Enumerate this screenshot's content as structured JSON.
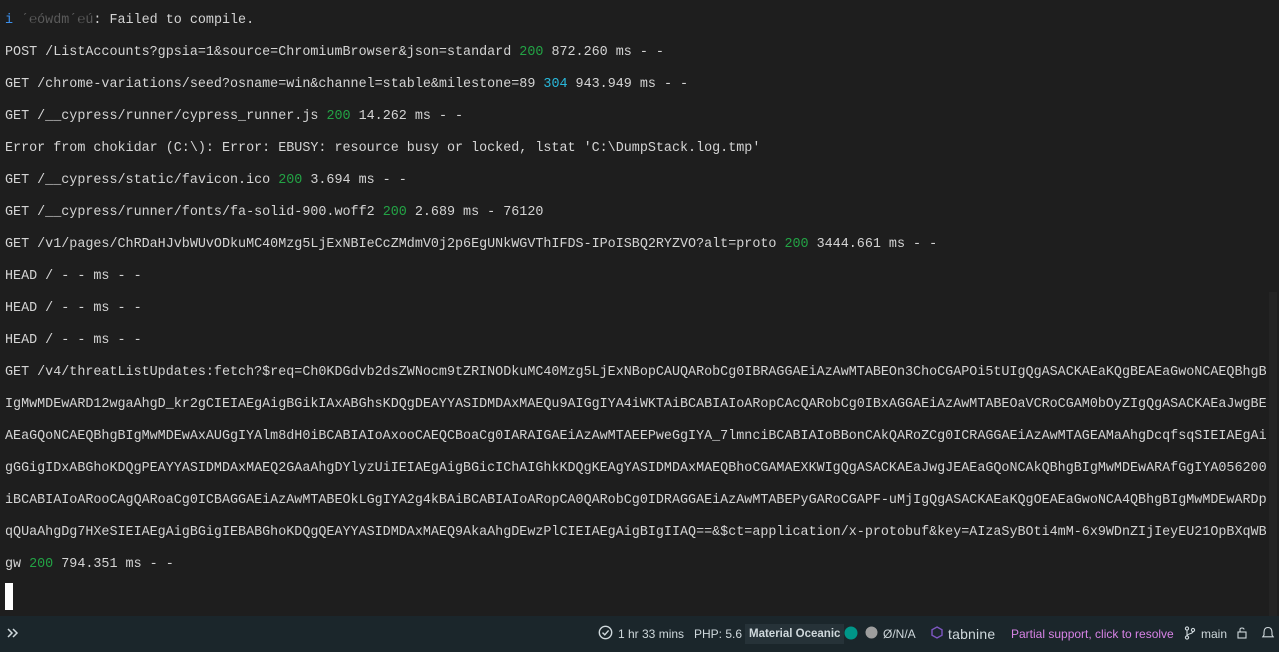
{
  "terminal": {
    "prefix_char": "i",
    "prefix_dim": "ˊ℮ówdmˊ℮ú",
    "status_colors": {
      "200": "#23a345",
      "304": "#29b8db"
    },
    "lines": [
      {
        "segs": [
          {
            "t": "i ",
            "c": "info"
          },
          {
            "t": "ˊ℮ówdmˊ℮ú",
            "c": "dim"
          },
          {
            "t": ": Failed to compile."
          }
        ]
      },
      {
        "segs": [
          {
            "t": "POST /ListAccounts?gpsia=1&source=ChromiumBrowser&json=standard "
          },
          {
            "t": "200",
            "c": "s200"
          },
          {
            "t": " 872.260 ms - -"
          }
        ]
      },
      {
        "segs": [
          {
            "t": "GET /chrome-variations/seed?osname=win&channel=stable&milestone=89 "
          },
          {
            "t": "304",
            "c": "s304"
          },
          {
            "t": " 943.949 ms - -"
          }
        ]
      },
      {
        "segs": [
          {
            "t": "GET /__cypress/runner/cypress_runner.js "
          },
          {
            "t": "200",
            "c": "s200"
          },
          {
            "t": " 14.262 ms - -"
          }
        ]
      },
      {
        "segs": [
          {
            "t": "Error from chokidar (C:\\): Error: EBUSY: resource busy or locked, lstat 'C:\\DumpStack.log.tmp'"
          }
        ]
      },
      {
        "segs": [
          {
            "t": "GET /__cypress/static/favicon.ico "
          },
          {
            "t": "200",
            "c": "s200"
          },
          {
            "t": " 3.694 ms - -"
          }
        ]
      },
      {
        "segs": [
          {
            "t": "GET /__cypress/runner/fonts/fa-solid-900.woff2 "
          },
          {
            "t": "200",
            "c": "s200"
          },
          {
            "t": " 2.689 ms - 76120"
          }
        ]
      },
      {
        "segs": [
          {
            "t": "GET /v1/pages/ChRDaHJvbWUvODkuMC40Mzg5LjExNBIeCcZMdmV0j2p6EgUNkWGVThIFDS-IPoISBQ2RYZVO?alt=proto "
          },
          {
            "t": "200",
            "c": "s200"
          },
          {
            "t": " 3444.661 ms - -"
          }
        ]
      },
      {
        "segs": [
          {
            "t": "HEAD / - - ms - -"
          }
        ]
      },
      {
        "segs": [
          {
            "t": "HEAD / - - ms - -"
          }
        ]
      },
      {
        "segs": [
          {
            "t": "HEAD / - - ms - -"
          }
        ]
      },
      {
        "segs": [
          {
            "t": "GET /v4/threatListUpdates:fetch?$req=Ch0KDGdvb2dsZWNocm9tZRINODkuMC40Mzg5LjExNBopCAUQARobCg0IBRAGGAEiAzAwMTABEOn3ChoCGAPOi5tUIgQgASACKAEaKQgBEAEaGwoNCAEQBhgB"
          }
        ]
      },
      {
        "segs": [
          {
            "t": "IgMwMDEwARD12wgaAhgD_kr2gCIEIAEgAigBGikIAxABGhsKDQgDEAYYASIDMDAxMAEQu9AIGgIYA4iWKTAiBCABIAIoARopCAcQARobCg0IBxAGGAEiAzAwMTABEOaVCRoCGAM0bOyZIgQgASACKAEaJwgBE"
          }
        ]
      },
      {
        "segs": [
          {
            "t": "AEaGQoNCAEQBhgBIgMwMDEwAxAUGgIYAlm8dH0iBCABIAIoAxooCAEQCBoaCg0IARAIGAEiAzAwMTAEEPweGgIYA_7lmnciBCABIAIoBBonCAkQARoZCg0ICRAGGAEiAzAwMTAGEAMaAhgDcqfsqSIEIAEgAi"
          }
        ]
      },
      {
        "segs": [
          {
            "t": "gGGigIDxABGhoKDQgPEAYYASIDMDAxMAEQ2GAaAhgDYlyzUiIEIAEgAigBGicIChAIGhkKDQgKEAgYASIDMDAxMAEQBhoCGAMAEXKWIgQgASACKAEaJwgJEAEaGQoNCAkQBhgBIgMwMDEwARAfGgIYA056200"
          }
        ]
      },
      {
        "segs": [
          {
            "t": "iBCABIAIoARooCAgQARoaCg0ICBAGGAEiAzAwMTABEOkLGgIYA2g4kBAiBCABIAIoARopCA0QARobCg0IDRAGGAEiAzAwMTABEPyGARoCGAPF-uMjIgQgASACKAEaKQgOEAEaGwoNCA4QBhgBIgMwMDEwARDp"
          }
        ]
      },
      {
        "segs": [
          {
            "t": "qQUaAhgDg7HXeSIEIAEgAigBGigIEBABGhoKDQgQEAYYASIDMDAxMAEQ9AkaAhgDEwzPlCIEIAEgAigBIgIIAQ==&$ct=application/x-protobuf&key=AIzaSyBOti4mM-6x9WDnZIjIeyEU21OpBXqWB"
          }
        ]
      },
      {
        "segs": [
          {
            "t": "gw "
          },
          {
            "t": "200",
            "c": "s200"
          },
          {
            "t": " 794.351 ms - -"
          }
        ]
      }
    ]
  },
  "statusbar": {
    "time": "1 hr 33 mins",
    "php": "PHP: 5.6",
    "theme": "Material Oceanic",
    "na": "Ø/N/A",
    "tabnine": "tabnine",
    "partial": "Partial support, click to resolve",
    "branch": "main",
    "colors": {
      "background": "#1b262b",
      "partial": "#d783e6",
      "dot": "#009688"
    },
    "icons": [
      "remote-icon",
      "clock-check-icon",
      "status-dot-icon",
      "gray-circle-icon",
      "tabnine-logo-icon",
      "branch-icon",
      "lock-icon",
      "bell-icon"
    ]
  }
}
